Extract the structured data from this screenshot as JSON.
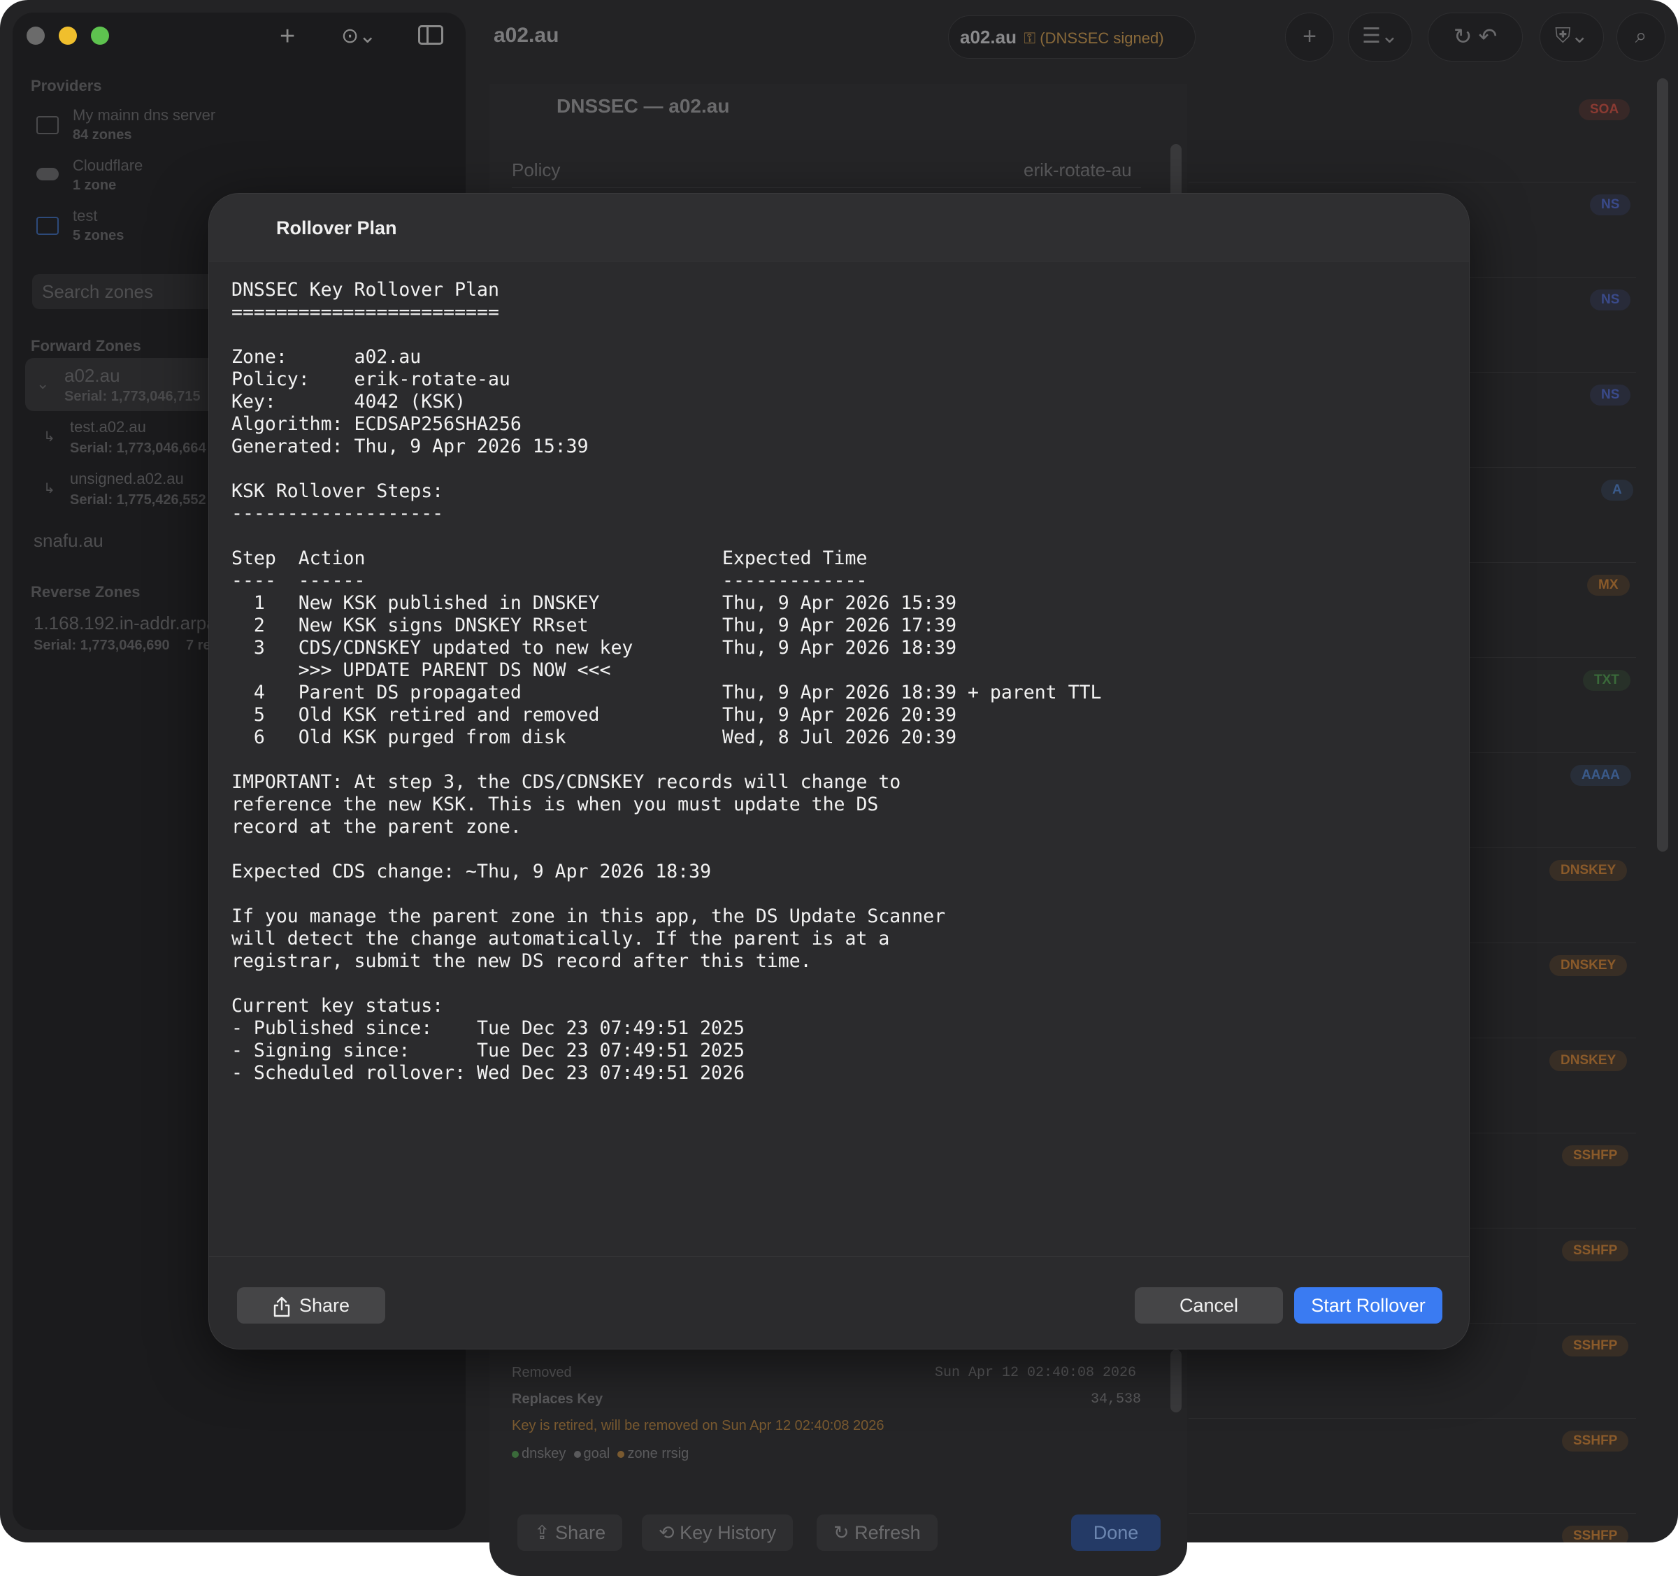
{
  "toolbar": {
    "window_title": "a02.au",
    "zone_pill": {
      "zone": "a02.au",
      "status": "(DNSSEC signed)"
    }
  },
  "sidebar": {
    "providers_header": "Providers",
    "providers": [
      {
        "name": "My mainn dns server",
        "count": "84 zones"
      },
      {
        "name": "Cloudflare",
        "count": "1 zone"
      },
      {
        "name": "test",
        "count": "5 zones"
      }
    ],
    "search_placeholder": "Search zones",
    "forward_header": "Forward Zones",
    "forward_zones": [
      {
        "name": "a02.au",
        "serial": "Serial: 1,773,046,715"
      },
      {
        "name": "test.a02.au",
        "serial": "Serial: 1,773,046,664"
      },
      {
        "name": "unsigned.a02.au",
        "serial": "Serial: 1,775,426,552"
      },
      {
        "name": "snafu.au",
        "serial": ""
      }
    ],
    "reverse_header": "Reverse Zones",
    "reverse_zones": [
      {
        "name": "1.168.192.in-addr.arpa",
        "serial": "Serial: 1,773,046,690",
        "extra": "7 re"
      }
    ]
  },
  "record_badges": [
    {
      "type": "SOA",
      "color": "#8a3a32"
    },
    {
      "type": "NS",
      "color": "#3a4a8a"
    },
    {
      "type": "NS",
      "color": "#3a4a8a"
    },
    {
      "type": "NS",
      "color": "#3a4a8a"
    },
    {
      "type": "A",
      "color": "#3a5a8a"
    },
    {
      "type": "MX",
      "color": "#8a5a2a"
    },
    {
      "type": "TXT",
      "color": "#3a6a3a"
    },
    {
      "type": "AAAA",
      "color": "#3a5a8a"
    },
    {
      "type": "DNSKEY",
      "color": "#8a5a2a"
    },
    {
      "type": "DNSKEY",
      "color": "#8a5a2a"
    },
    {
      "type": "DNSKEY",
      "color": "#8a5a2a"
    },
    {
      "type": "SSHFP",
      "color": "#8a5a2a"
    },
    {
      "type": "SSHFP",
      "color": "#8a5a2a"
    },
    {
      "type": "SSHFP",
      "color": "#8a5a2a"
    },
    {
      "type": "SSHFP",
      "color": "#8a5a2a"
    },
    {
      "type": "SSHFP",
      "color": "#8a5a2a"
    }
  ],
  "dnssec_sheet": {
    "title": "DNSSEC — a02.au",
    "policy_label": "Policy",
    "policy_value": "erik-rotate-au",
    "removed_label": "Removed",
    "removed_value": "Sun Apr 12 02:40:08 2026",
    "replaces_label": "Replaces Key",
    "replaces_value": "34,538",
    "retired_note": "Key is retired, will be removed on Sun Apr 12 02:40:08 2026",
    "tags": [
      "dnskey",
      "goal",
      "zone rrsig"
    ],
    "share": "Share",
    "key_history": "Key History",
    "refresh": "Refresh",
    "done": "Done"
  },
  "modal": {
    "title": "Rollover Plan",
    "plan_text": "DNSSEC Key Rollover Plan\n========================\n\nZone:      a02.au\nPolicy:    erik-rotate-au\nKey:       4042 (KSK)\nAlgorithm: ECDSAP256SHA256\nGenerated: Thu, 9 Apr 2026 15:39\n\nKSK Rollover Steps:\n-------------------\n\nStep  Action                                Expected Time\n----  ------                                -------------\n  1   New KSK published in DNSKEY           Thu, 9 Apr 2026 15:39\n  2   New KSK signs DNSKEY RRset            Thu, 9 Apr 2026 17:39\n  3   CDS/CDNSKEY updated to new key        Thu, 9 Apr 2026 18:39\n      >>> UPDATE PARENT DS NOW <<<\n  4   Parent DS propagated                  Thu, 9 Apr 2026 18:39 + parent TTL\n  5   Old KSK retired and removed           Thu, 9 Apr 2026 20:39\n  6   Old KSK purged from disk              Wed, 8 Jul 2026 20:39\n\nIMPORTANT: At step 3, the CDS/CDNSKEY records will change to\nreference the new KSK. This is when you must update the DS\nrecord at the parent zone.\n\nExpected CDS change: ~Thu, 9 Apr 2026 18:39\n\nIf you manage the parent zone in this app, the DS Update Scanner\nwill detect the change automatically. If the parent is at a\nregistrar, submit the new DS record after this time.\n\nCurrent key status:\n- Published since:    Tue Dec 23 07:49:51 2025\n- Signing since:      Tue Dec 23 07:49:51 2025\n- Scheduled rollover: Wed Dec 23 07:49:51 2026",
    "share_label": "Share",
    "cancel_label": "Cancel",
    "start_label": "Start Rollover"
  }
}
